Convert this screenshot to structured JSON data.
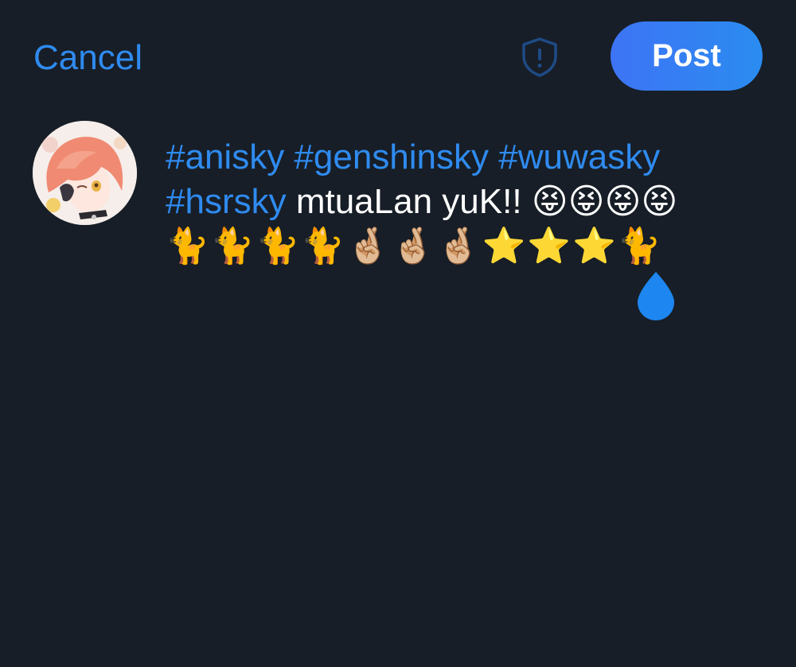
{
  "header": {
    "cancel_label": "Cancel",
    "post_label": "Post",
    "shield_icon": "shield-alert-icon"
  },
  "composer": {
    "hashtags_line1": [
      "#anisky",
      "#genshinsky",
      "#wuwasky"
    ],
    "hashtag_line2": "#hsrsky",
    "text_line2": " mtuaLan yuK!! 😝😝😝😝",
    "emoji_line3": "🐈🐈🐈🐈🤞🏼🤞🏼🤞🏼⭐⭐⭐🐈"
  },
  "colors": {
    "background": "#171e27",
    "accent": "#2f8bf0",
    "post_gradient_start": "#3d74f5",
    "post_gradient_end": "#2a8cf0"
  }
}
